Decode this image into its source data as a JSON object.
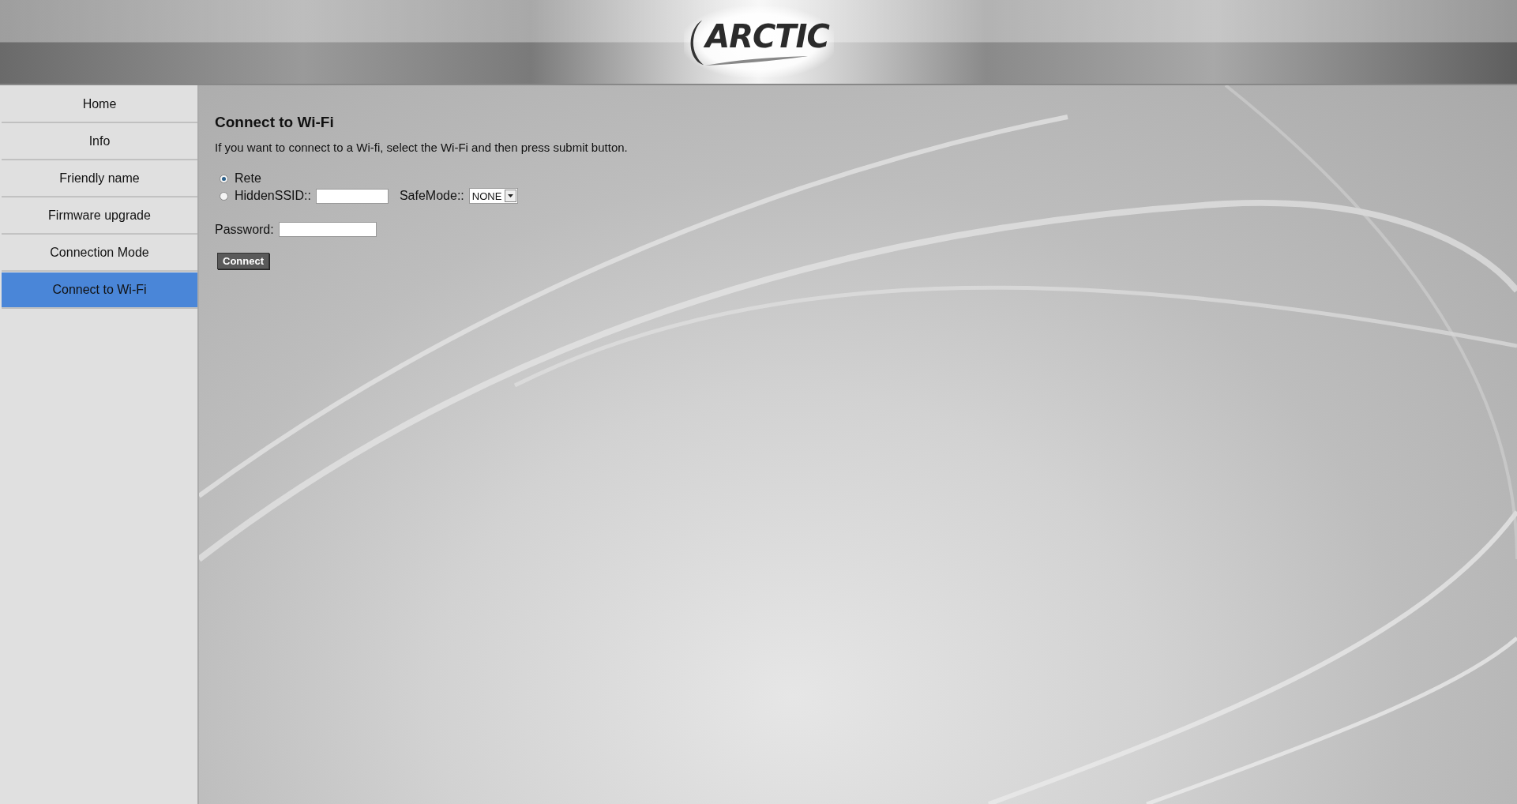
{
  "header": {
    "logo": "ARCTIC"
  },
  "sidebar": {
    "items": [
      {
        "label": "Home",
        "selected": false
      },
      {
        "label": "Info",
        "selected": false
      },
      {
        "label": "Friendly name",
        "selected": false
      },
      {
        "label": "Firmware upgrade",
        "selected": false
      },
      {
        "label": "Connection Mode",
        "selected": false
      },
      {
        "label": "Connect to Wi-Fi",
        "selected": true
      }
    ]
  },
  "form": {
    "title": "Connect to Wi-Fi",
    "description": "If you want to connect to a Wi-fi, select the Wi-Fi and then press submit button.",
    "options": [
      {
        "label": "Rete",
        "selected": true
      },
      {
        "label": "HiddenSSID::",
        "selected": false
      }
    ],
    "safe_mode": {
      "label": "SafeMode::",
      "value": "NONE"
    },
    "password": {
      "label": "Password:"
    },
    "submit": "Connect"
  }
}
